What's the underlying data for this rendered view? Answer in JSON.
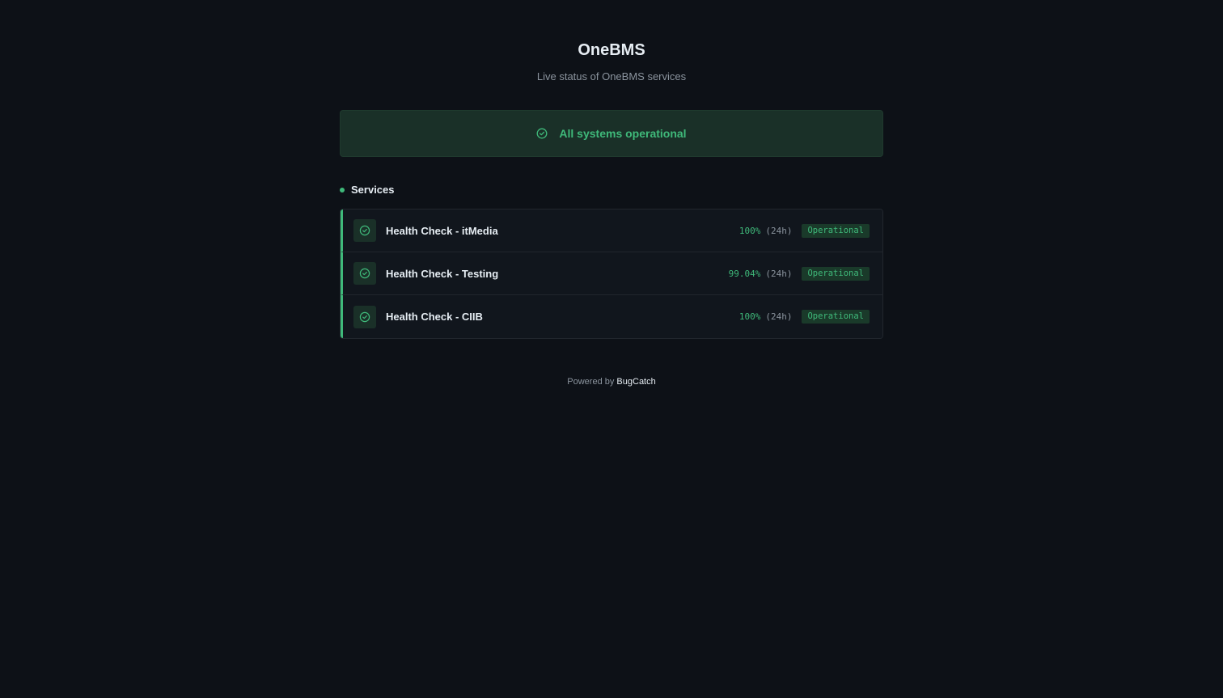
{
  "header": {
    "title": "OneBMS",
    "subtitle": "Live status of OneBMS services"
  },
  "banner": {
    "icon": "check-circle-icon",
    "text": "All systems operational",
    "color": "#3fb97a"
  },
  "services_section": {
    "title": "Services",
    "items": [
      {
        "name": "Health Check - itMedia",
        "uptime": "100%",
        "window": "(24h)",
        "status": "Operational",
        "icon": "check-circle-icon"
      },
      {
        "name": "Health Check - Testing",
        "uptime": "99.04%",
        "window": "(24h)",
        "status": "Operational",
        "icon": "check-circle-icon"
      },
      {
        "name": "Health Check - CIIB",
        "uptime": "100%",
        "window": "(24h)",
        "status": "Operational",
        "icon": "check-circle-icon"
      }
    ]
  },
  "footer": {
    "prefix": "Powered by",
    "link_label": "BugCatch"
  },
  "colors": {
    "background": "#0d1117",
    "accent": "#3fb97a",
    "banner_bg": "#1a3028"
  }
}
